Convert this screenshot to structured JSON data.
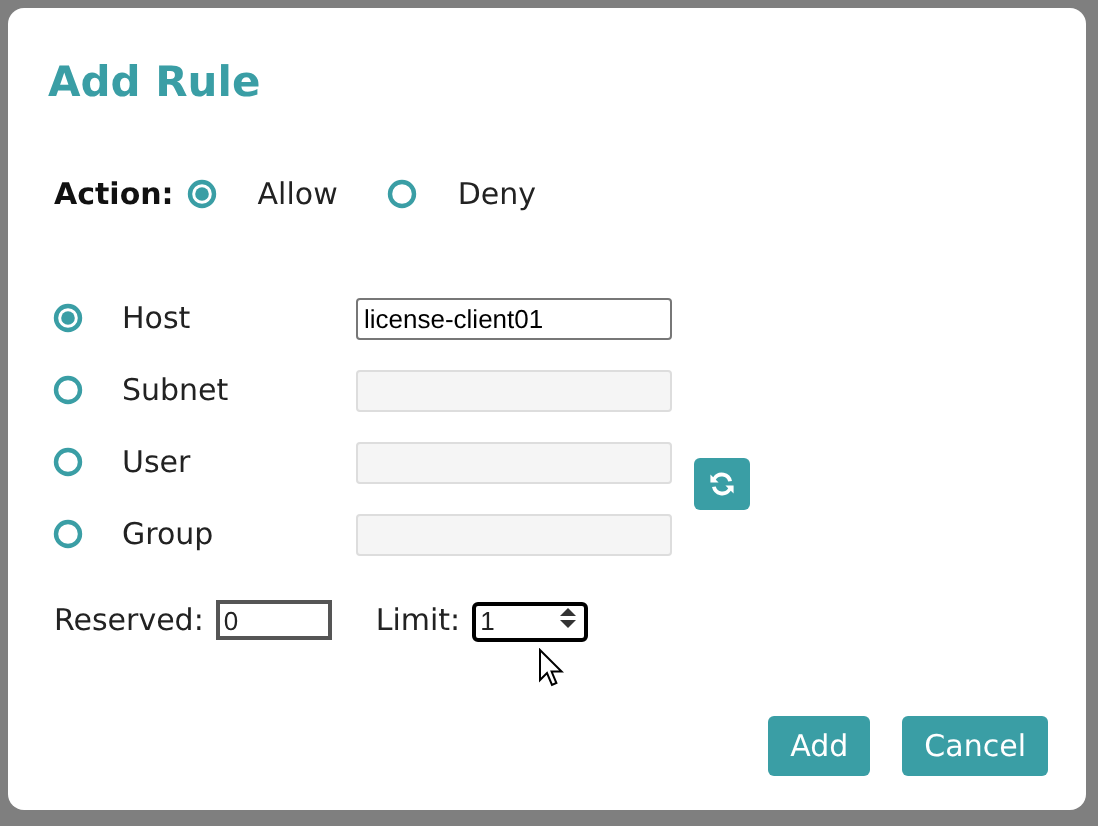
{
  "dialog": {
    "title": "Add Rule"
  },
  "action": {
    "label": "Action:",
    "options": [
      {
        "label": "Allow",
        "selected": true
      },
      {
        "label": "Deny",
        "selected": false
      }
    ]
  },
  "targets": [
    {
      "label": "Host",
      "selected": true,
      "value": "license-client01",
      "disabled": false
    },
    {
      "label": "Subnet",
      "selected": false,
      "disabled": true
    },
    {
      "label": "User",
      "selected": false,
      "disabled": true
    },
    {
      "label": "Group",
      "selected": false,
      "disabled": true
    }
  ],
  "reserved": {
    "label": "Reserved:",
    "value": "0"
  },
  "limit": {
    "label": "Limit:",
    "value": "1"
  },
  "buttons": [
    {
      "label": "Add"
    },
    {
      "label": "Cancel"
    }
  ]
}
